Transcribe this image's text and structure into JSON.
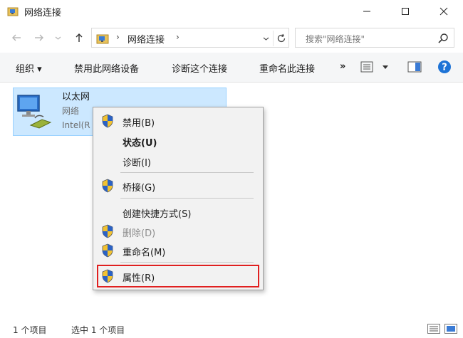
{
  "window": {
    "title": "网络连接",
    "controls": {
      "minimize": "minimize-icon",
      "maximize": "maximize-icon",
      "close": "close-icon"
    }
  },
  "address_bar": {
    "path": "网络连接",
    "search_placeholder": "搜索\"网络连接\""
  },
  "toolbar": {
    "organize": "组织 ▾",
    "disable_device": "禁用此网络设备",
    "diagnose": "诊断这个连接",
    "rename": "重命名此连接",
    "more": "»"
  },
  "adapter": {
    "name": "以太网",
    "network": "网络",
    "device": "Intel(R"
  },
  "context_menu": {
    "items": [
      {
        "label": "禁用(B)",
        "shield": true
      },
      {
        "label": "状态(U)",
        "bold": true
      },
      {
        "label": "诊断(I)"
      },
      {
        "label": "桥接(G)",
        "shield": true
      },
      {
        "label": "创建快捷方式(S)"
      },
      {
        "label": "删除(D)",
        "shield": true,
        "disabled": true
      },
      {
        "label": "重命名(M)",
        "shield": true
      },
      {
        "label": "属性(R)",
        "shield": true,
        "highlighted": true
      }
    ]
  },
  "status_bar": {
    "item_count": "1 个项目",
    "selected_count": "选中 1 个项目"
  },
  "colors": {
    "selection_fill": "#cce8ff",
    "selection_border": "#99d1ff",
    "highlight_box": "#e02020",
    "help_blue": "#1e73d6"
  }
}
